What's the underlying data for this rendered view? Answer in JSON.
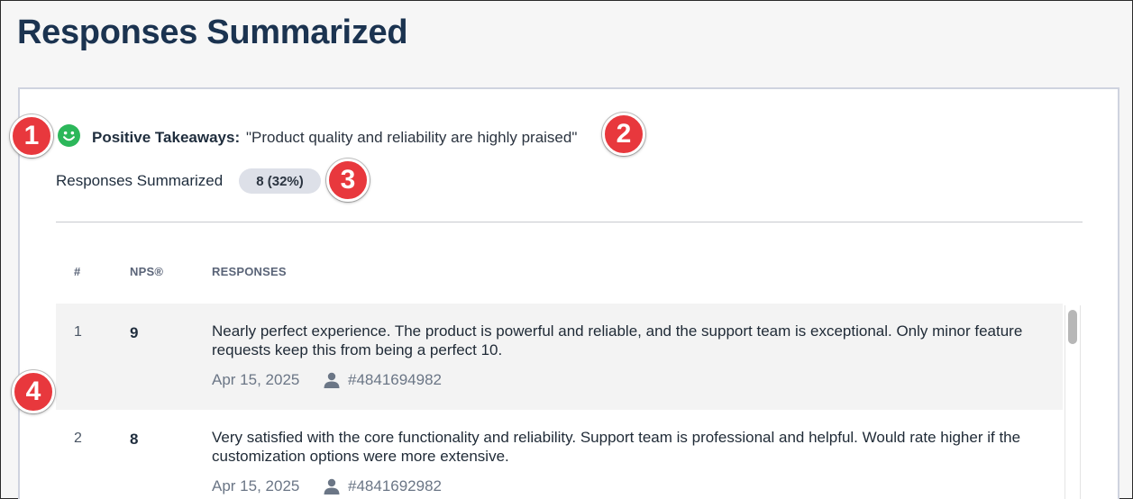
{
  "page": {
    "title": "Responses Summarized"
  },
  "markers": [
    "1",
    "2",
    "3",
    "4"
  ],
  "takeaway": {
    "icon": "smile-icon",
    "icon_color": "#2cb75a",
    "label": "Positive Takeaways:",
    "quote": "\"Product quality and reliability are highly praised\""
  },
  "summary": {
    "label": "Responses Summarized",
    "badge": "8 (32%)"
  },
  "table": {
    "columns": [
      "#",
      "NPS®",
      "RESPONSES"
    ],
    "rows": [
      {
        "num": "1",
        "nps": "9",
        "text": "Nearly perfect experience. The product is powerful and reliable, and the support team is exceptional. Only minor feature requests keep this from being a perfect 10.",
        "date": "Apr 15, 2025",
        "respondent": "#4841694982"
      },
      {
        "num": "2",
        "nps": "8",
        "text": "Very satisfied with the core functionality and reliability. Support team is professional and helpful. Would rate higher if the customization options were more extensive.",
        "date": "Apr 15, 2025",
        "respondent": "#4841692982"
      }
    ]
  },
  "colors": {
    "accent_marker": "#e8383d",
    "title": "#1b3350"
  }
}
